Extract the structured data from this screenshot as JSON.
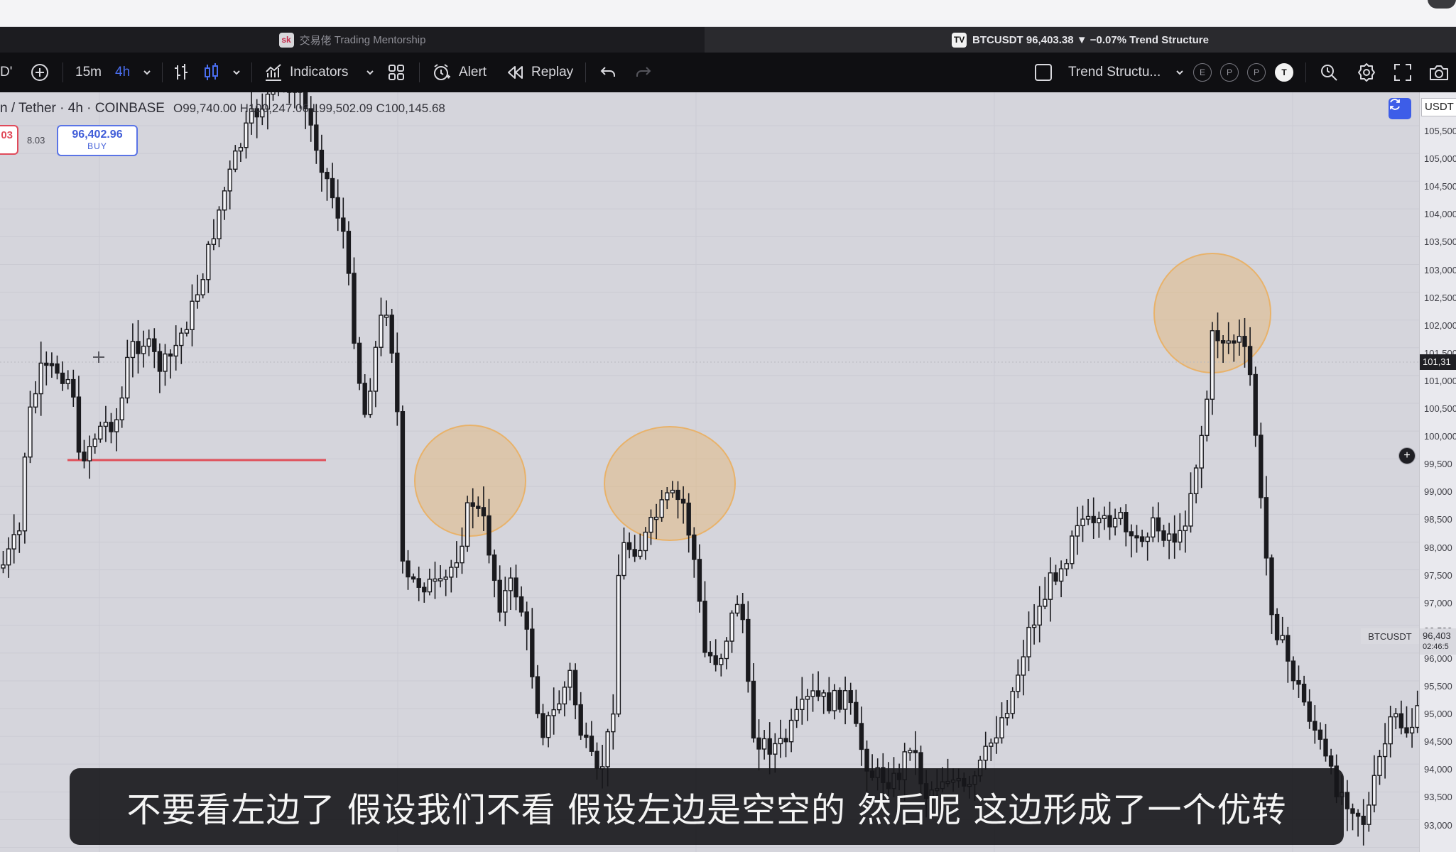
{
  "browser": {
    "tabs": [
      {
        "label": "Trading Mentorship",
        "prefix": "交易佬",
        "icon": "sk-logo-icon",
        "icon_text": "sk",
        "active": false
      },
      {
        "label": "BTCUSDT 96,403.38 ▼ −0.07% Trend Structure",
        "icon": "tradingview-logo-icon",
        "icon_text": "TV",
        "active": true
      }
    ]
  },
  "toolbar": {
    "symbol_fragment": "D'",
    "interval_1": "15m",
    "interval_2": "4h",
    "indicators_label": "Indicators",
    "alert_label": "Alert",
    "replay_label": "Replay",
    "indicator_name": "Trend Structu...",
    "circle_buttons": [
      "E",
      "P",
      "P",
      "T"
    ]
  },
  "legend": {
    "symbol": "n / Tether · 4h · COINBASE",
    "open": "O99,740.00",
    "high": "H100,247.06",
    "low": "L99,502.09",
    "close": "C100,145.68"
  },
  "trade": {
    "sell_fragment": "03",
    "spread": "8.03",
    "buy_price": "96,402.96",
    "buy_label": "BUY"
  },
  "axis": {
    "currency": "USDT",
    "ticks": [
      "105,500",
      "105,000",
      "104,500",
      "104,000",
      "103,500",
      "103,000",
      "102,500",
      "102,000",
      "101,500",
      "101,000",
      "100,500",
      "100,000",
      "99,500",
      "99,000",
      "98,500",
      "98,000",
      "97,500",
      "97,000",
      "96,500",
      "96,000",
      "95,500",
      "95,000",
      "94,500",
      "94,000",
      "93,500",
      "93,000"
    ],
    "crosshair_price": "101,31",
    "last_price": "96,403",
    "countdown": "02:46:5",
    "symbol_tag": "BTCUSDT"
  },
  "subtitle": {
    "text": "不要看左边了 假设我们不看 假设左边是空空的 然后呢 这边形成了一个优转"
  },
  "colors": {
    "chart_bg": "#d5d5dc",
    "candle": "#1a1a1e",
    "highlight": "#e8b26a",
    "support_line": "#e0505a",
    "accent": "#3d5de8"
  }
}
